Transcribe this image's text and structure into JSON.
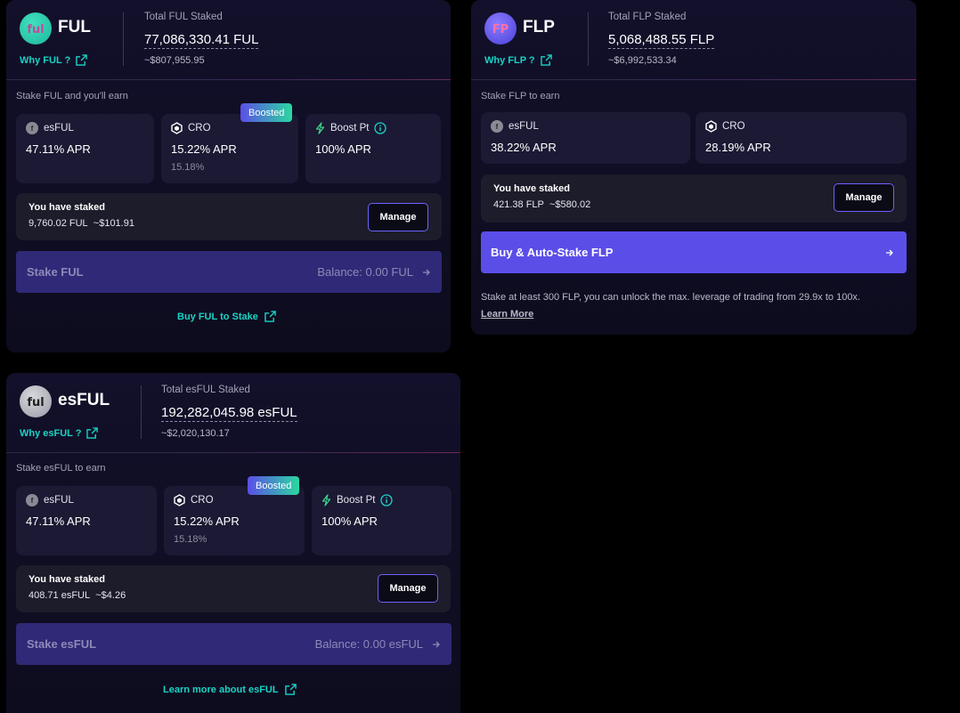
{
  "ful": {
    "name": "FUL",
    "why": "Why FUL ?",
    "total_label": "Total FUL Staked",
    "total_value": "77,086,330.41 FUL",
    "total_usd": "~$807,955.95",
    "earn_label": "Stake FUL and you'll earn",
    "rewards": [
      {
        "name": "esFUL",
        "apr": "47.11% APR",
        "sub": ""
      },
      {
        "name": "CRO",
        "apr": "15.22% APR",
        "sub": "15.18%",
        "badge": "Boosted"
      },
      {
        "name": "Boost Pt",
        "apr": "100% APR",
        "sub": ""
      }
    ],
    "staked_title": "You have staked",
    "staked_amount": "9,760.02 FUL",
    "staked_usd": "~$101.91",
    "manage": "Manage",
    "stake_label": "Stake FUL",
    "balance": "Balance: 0.00 FUL",
    "buy_link": "Buy FUL to Stake"
  },
  "flp": {
    "name": "FLP",
    "why": "Why FLP ?",
    "total_label": "Total FLP Staked",
    "total_value": "5,068,488.55 FLP",
    "total_usd": "~$6,992,533.34",
    "earn_label": "Stake FLP to earn",
    "rewards": [
      {
        "name": "esFUL",
        "apr": "38.22% APR"
      },
      {
        "name": "CRO",
        "apr": "28.19% APR"
      }
    ],
    "staked_title": "You have staked",
    "staked_amount": "421.38 FLP",
    "staked_usd": "~$580.02",
    "manage": "Manage",
    "buy_label": "Buy & Auto-Stake FLP",
    "note": "Stake at least 300 FLP, you can unlock the max. leverage of trading from 29.9x to 100x.",
    "learn_more": "Learn More"
  },
  "esful": {
    "name": "esFUL",
    "why": "Why esFUL ?",
    "total_label": "Total esFUL Staked",
    "total_value": "192,282,045.98 esFUL",
    "total_usd": "~$2,020,130.17",
    "earn_label": "Stake esFUL to earn",
    "rewards": [
      {
        "name": "esFUL",
        "apr": "47.11% APR",
        "sub": ""
      },
      {
        "name": "CRO",
        "apr": "15.22% APR",
        "sub": "15.18%",
        "badge": "Boosted"
      },
      {
        "name": "Boost Pt",
        "apr": "100% APR",
        "sub": ""
      }
    ],
    "staked_title": "You have staked",
    "staked_amount": "408.71 esFUL",
    "staked_usd": "~$4.26",
    "manage": "Manage",
    "stake_label": "Stake esFUL",
    "balance": "Balance: 0.00 esFUL",
    "learn_link": "Learn more about esFUL"
  },
  "colors": {
    "accent": "#5b4ee8",
    "link": "#19d3c5",
    "boosted_from": "#5b4ee8",
    "boosted_to": "#2bd8a0"
  },
  "icons": [
    "ful-logo",
    "flp-logo",
    "esful-logo",
    "external-link-icon",
    "cro-icon",
    "bolt-icon",
    "info-icon",
    "arrow-right-icon"
  ]
}
